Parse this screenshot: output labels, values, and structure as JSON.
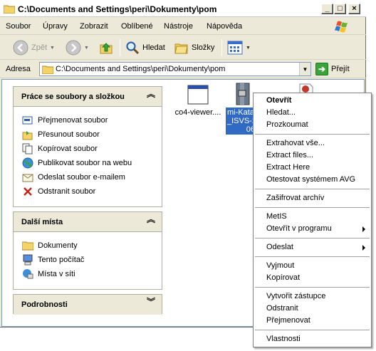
{
  "window": {
    "title": "C:\\Documents and Settings\\peri\\Dokumenty\\pom",
    "controls": [
      "_",
      "□",
      "×"
    ]
  },
  "menu": [
    "Soubor",
    "Úpravy",
    "Zobrazit",
    "Oblíbené",
    "Nástroje",
    "Nápověda"
  ],
  "toolbar": {
    "back_label": "Zpět",
    "search_label": "Hledat",
    "folders_label": "Složky"
  },
  "address": {
    "label": "Adresa",
    "value": "C:\\Documents and Settings\\peri\\Dokumenty\\pom",
    "go_label": "Přejít"
  },
  "panels": {
    "file_tasks": {
      "title": "Práce se soubory a složkou",
      "items": [
        {
          "label": "Přejmenovat soubor",
          "icon": "rename-icon"
        },
        {
          "label": "Přesunout soubor",
          "icon": "move-icon"
        },
        {
          "label": "Kopírovat soubor",
          "icon": "copy-icon"
        },
        {
          "label": "Publikovat soubor na webu",
          "icon": "globe-icon"
        },
        {
          "label": "Odeslat soubor e-mailem",
          "icon": "email-icon"
        },
        {
          "label": "Odstranit soubor",
          "icon": "delete-icon"
        }
      ]
    },
    "other_places": {
      "title": "Další místa",
      "items": [
        {
          "label": "Dokumenty",
          "icon": "folder-icon"
        },
        {
          "label": "Tento počítač",
          "icon": "computer-icon"
        },
        {
          "label": "Místa v síti",
          "icon": "network-icon"
        }
      ]
    },
    "details": {
      "title": "Podrobnosti"
    }
  },
  "files": [
    {
      "label": "co4-viewer....",
      "icon": "window-app-icon",
      "selected": false
    },
    {
      "label_lines": [
        "mi-Kata",
        "_ISVS-2",
        "06."
      ],
      "icon": "archive-icon",
      "selected": true
    }
  ],
  "context_menu": {
    "groups": [
      [
        {
          "label": "Otevřít",
          "bold": true
        },
        {
          "label": "Hledat..."
        },
        {
          "label": "Prozkoumat"
        }
      ],
      [
        {
          "label": "Extrahovat vše..."
        },
        {
          "label": "Extract files..."
        },
        {
          "label": "Extract Here"
        },
        {
          "label": "Otestovat systémem AVG"
        }
      ],
      [
        {
          "label": "Zašifrovat archív"
        }
      ],
      [
        {
          "label": "MetIS"
        },
        {
          "label": "Otevřít v programu",
          "submenu": true
        }
      ],
      [
        {
          "label": "Odeslat",
          "submenu": true
        }
      ],
      [
        {
          "label": "Vyjmout"
        },
        {
          "label": "Kopírovat"
        }
      ],
      [
        {
          "label": "Vytvořit zástupce"
        },
        {
          "label": "Odstranit"
        },
        {
          "label": "Přejmenovat"
        }
      ],
      [
        {
          "label": "Vlastnosti"
        }
      ]
    ]
  },
  "colors": {
    "selection": "#316ac5",
    "panel_header": "#ece9d8",
    "go_green": "#3ca33c"
  }
}
